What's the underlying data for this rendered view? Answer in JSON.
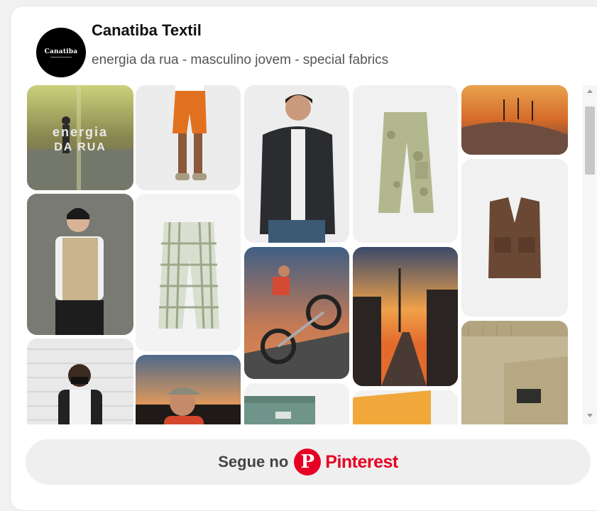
{
  "profile": {
    "avatar_text": "Canatiba",
    "name": "Canatiba Textil",
    "description": "energia da rua - masculino jovem - special fabrics"
  },
  "pins": [
    {
      "id": "pin-energia-da-rua",
      "overlay": "energia\nDA RUA"
    },
    {
      "id": "pin-orange-shorts"
    },
    {
      "id": "pin-model-black-jacket"
    },
    {
      "id": "pin-camo-cargo-pants"
    },
    {
      "id": "pin-skatepark-sunset"
    },
    {
      "id": "pin-model-tan-vest"
    },
    {
      "id": "pin-plaid-cargo-pants"
    },
    {
      "id": "pin-brown-utility-vest"
    },
    {
      "id": "pin-bmx-rider"
    },
    {
      "id": "pin-city-sunset-street"
    },
    {
      "id": "pin-model-bandana-wall"
    },
    {
      "id": "pin-model-cap-sunset"
    },
    {
      "id": "pin-green-shorts-detail"
    },
    {
      "id": "pin-yellow-garment"
    },
    {
      "id": "pin-khaki-pants-detail"
    }
  ],
  "follow_button": {
    "prefix": "Segue no",
    "brand": "Pinterest",
    "brand_color": "#e60023"
  }
}
